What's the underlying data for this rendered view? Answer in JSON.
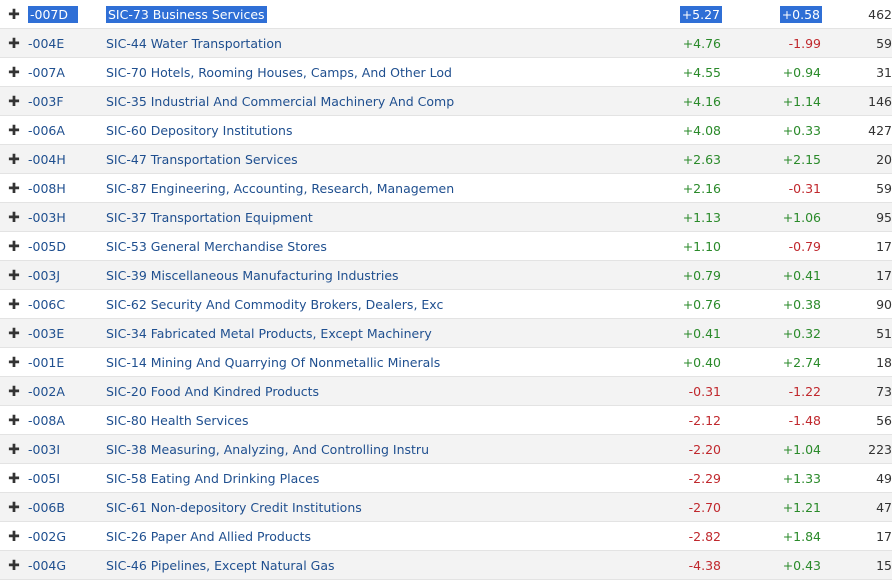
{
  "rows": [
    {
      "code": "-007D",
      "name": "SIC-73 Business Services",
      "change1": "+5.27",
      "change2": "+0.58",
      "count": "462",
      "selected": true
    },
    {
      "code": "-004E",
      "name": "SIC-44 Water Transportation",
      "change1": "+4.76",
      "change2": "-1.99",
      "count": "59"
    },
    {
      "code": "-007A",
      "name": "SIC-70 Hotels, Rooming Houses, Camps, And Other Lod",
      "change1": "+4.55",
      "change2": "+0.94",
      "count": "31"
    },
    {
      "code": "-003F",
      "name": "SIC-35 Industrial And Commercial Machinery And Comp",
      "change1": "+4.16",
      "change2": "+1.14",
      "count": "146"
    },
    {
      "code": "-006A",
      "name": "SIC-60 Depository Institutions",
      "change1": "+4.08",
      "change2": "+0.33",
      "count": "427"
    },
    {
      "code": "-004H",
      "name": "SIC-47 Transportation Services",
      "change1": "+2.63",
      "change2": "+2.15",
      "count": "20"
    },
    {
      "code": "-008H",
      "name": "SIC-87 Engineering, Accounting, Research, Managemen",
      "change1": "+2.16",
      "change2": "-0.31",
      "count": "59"
    },
    {
      "code": "-003H",
      "name": "SIC-37 Transportation Equipment",
      "change1": "+1.13",
      "change2": "+1.06",
      "count": "95"
    },
    {
      "code": "-005D",
      "name": "SIC-53 General Merchandise Stores",
      "change1": "+1.10",
      "change2": "-0.79",
      "count": "17"
    },
    {
      "code": "-003J",
      "name": "SIC-39 Miscellaneous Manufacturing Industries",
      "change1": "+0.79",
      "change2": "+0.41",
      "count": "17"
    },
    {
      "code": "-006C",
      "name": "SIC-62 Security And Commodity Brokers, Dealers, Exc",
      "change1": "+0.76",
      "change2": "+0.38",
      "count": "90"
    },
    {
      "code": "-003E",
      "name": "SIC-34 Fabricated Metal Products, Except Machinery",
      "change1": "+0.41",
      "change2": "+0.32",
      "count": "51"
    },
    {
      "code": "-001E",
      "name": "SIC-14 Mining And Quarrying Of Nonmetallic Minerals",
      "change1": "+0.40",
      "change2": "+2.74",
      "count": "18"
    },
    {
      "code": "-002A",
      "name": "SIC-20 Food And Kindred Products",
      "change1": "-0.31",
      "change2": "-1.22",
      "count": "73"
    },
    {
      "code": "-008A",
      "name": "SIC-80 Health Services",
      "change1": "-2.12",
      "change2": "-1.48",
      "count": "56"
    },
    {
      "code": "-003I",
      "name": "SIC-38 Measuring, Analyzing, And Controlling Instru",
      "change1": "-2.20",
      "change2": "+1.04",
      "count": "223"
    },
    {
      "code": "-005I",
      "name": "SIC-58 Eating And Drinking Places",
      "change1": "-2.29",
      "change2": "+1.33",
      "count": "49"
    },
    {
      "code": "-006B",
      "name": "SIC-61 Non-depository Credit Institutions",
      "change1": "-2.70",
      "change2": "+1.21",
      "count": "47"
    },
    {
      "code": "-002G",
      "name": "SIC-26 Paper And Allied Products",
      "change1": "-2.82",
      "change2": "+1.84",
      "count": "17"
    },
    {
      "code": "-004G",
      "name": "SIC-46 Pipelines, Except Natural Gas",
      "change1": "-4.38",
      "change2": "+0.43",
      "count": "15"
    }
  ],
  "icons": {
    "expand": "plus-icon"
  },
  "colors": {
    "positive": "#2a8a2a",
    "negative": "#c0282d",
    "link": "#1f4f8f",
    "selection": "#2f6fd6"
  },
  "expand_glyph": "✚"
}
